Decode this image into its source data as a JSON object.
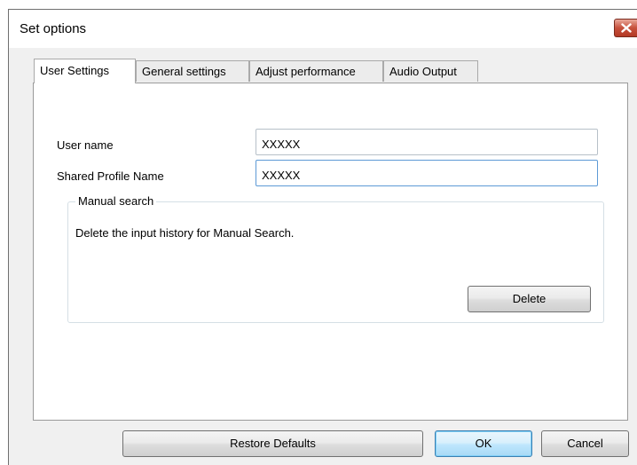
{
  "window": {
    "title": "Set options"
  },
  "tabs": [
    {
      "label": "User Settings",
      "active": true
    },
    {
      "label": "General settings",
      "active": false
    },
    {
      "label": "Adjust performance",
      "active": false
    },
    {
      "label": "Audio Output",
      "active": false
    }
  ],
  "user_settings": {
    "user_name_label": "User name",
    "user_name_value": "XXXXX",
    "shared_profile_label": "Shared Profile Name",
    "shared_profile_value": "XXXXX",
    "manual_search": {
      "legend": "Manual search",
      "description": "Delete the input history for Manual Search.",
      "delete_label": "Delete"
    }
  },
  "footer": {
    "restore_label": "Restore Defaults",
    "ok_label": "OK",
    "cancel_label": "Cancel"
  },
  "colors": {
    "close_button": "#c7503c",
    "default_button_border": "#3c7fb1",
    "focused_field_border": "#5d9ad6"
  },
  "icons": {
    "close": "close-icon"
  }
}
